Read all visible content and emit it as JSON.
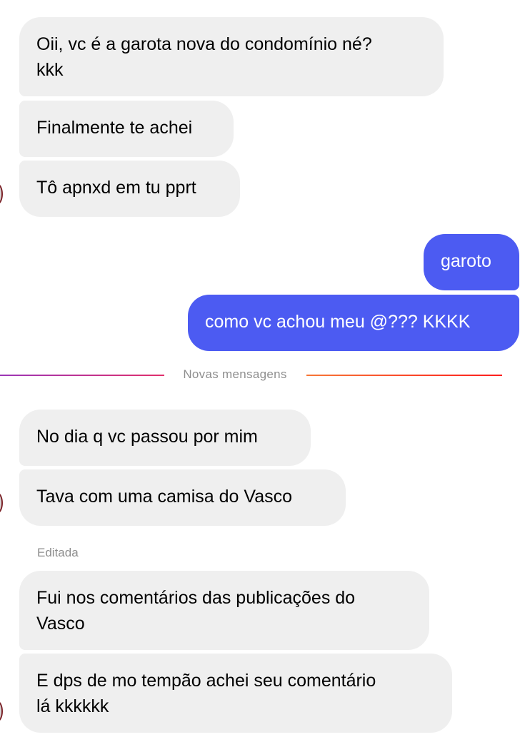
{
  "colors": {
    "incoming_bubble": "#efefef",
    "outgoing_bubble": "#4c5bf2",
    "divider_gradient": [
      "#9b36b7",
      "#e1306c",
      "#f77737",
      "#fd1d1d"
    ]
  },
  "messages": [
    {
      "sender": "them",
      "text": "Oii, vc é a garota nova do condomínio né?\nkkk"
    },
    {
      "sender": "them",
      "text": "Finalmente te achei"
    },
    {
      "sender": "them",
      "text": "Tô apnxd em tu pprt"
    },
    {
      "sender": "me",
      "text": "garoto"
    },
    {
      "sender": "me",
      "text": "como vc achou meu @??? KKKK"
    },
    {
      "sender": "them",
      "text": "No dia q vc passou por mim"
    },
    {
      "sender": "them",
      "text": "Tava com uma camisa do Vasco"
    },
    {
      "sender": "them",
      "text": "Fui nos comentários das publicações do\nVasco"
    },
    {
      "sender": "them",
      "text": "E dps de mo tempão achei seu comentário\nlá kkkkkk"
    }
  ],
  "divider": {
    "label": "Novas mensagens"
  },
  "edited_label": "Editada",
  "icons": {
    "avatar": "contact-avatar-icon"
  }
}
